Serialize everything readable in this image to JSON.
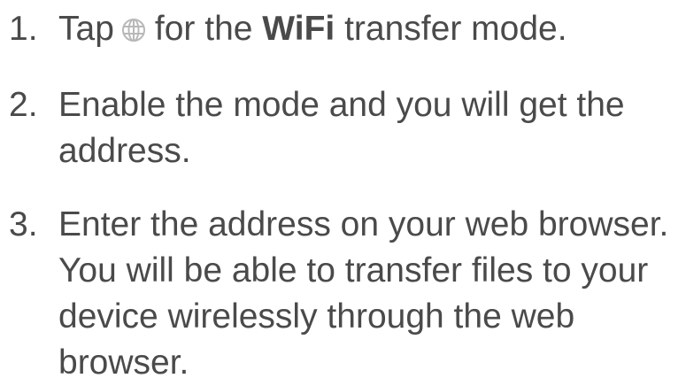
{
  "steps": [
    {
      "number": "1.",
      "lines": [
        {
          "before_icon": "Tap",
          "icon": "globe-icon",
          "after_icon": "for the ",
          "bold": "WiFi",
          "after_bold": " transfer mode."
        }
      ]
    },
    {
      "number": "2.",
      "lines": [
        "Enable the mode and you will get the",
        "address."
      ]
    },
    {
      "number": "3.",
      "lines": [
        "Enter the address on your web browser.",
        "You will be able to transfer files to your",
        "device wirelessly through the web",
        "browser."
      ]
    }
  ],
  "colors": {
    "text": "#4a4a4a",
    "icon": "#b8b8b8"
  }
}
